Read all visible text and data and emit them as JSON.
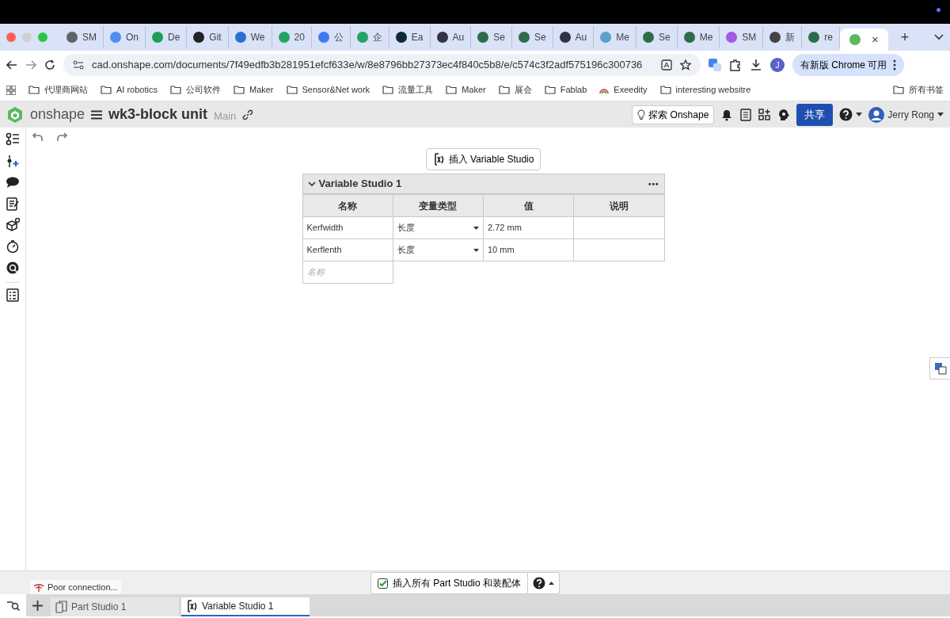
{
  "browser": {
    "tabs": [
      {
        "label": "SM",
        "color": "#5f6368",
        "selected": false
      },
      {
        "label": "On",
        "color": "#4f8df5",
        "selected": false
      },
      {
        "label": "De",
        "color": "#1e9e55",
        "selected": false
      },
      {
        "label": "Git",
        "color": "#222222",
        "selected": false
      },
      {
        "label": "We",
        "color": "#2a6fd6",
        "selected": false
      },
      {
        "label": "20",
        "color": "#21a464",
        "selected": false
      },
      {
        "label": "公",
        "color": "#3b7cf0",
        "selected": false
      },
      {
        "label": "企",
        "color": "#21a464",
        "selected": false
      },
      {
        "label": "Ea",
        "color": "#0d2a3a",
        "selected": false
      },
      {
        "label": "Au",
        "color": "#333344",
        "selected": false
      },
      {
        "label": "Se",
        "color": "#2e6b4a",
        "selected": false
      },
      {
        "label": "Se",
        "color": "#2e6b4a",
        "selected": false
      },
      {
        "label": "Au",
        "color": "#333344",
        "selected": false
      },
      {
        "label": "Me",
        "color": "#5aa0c8",
        "selected": false
      },
      {
        "label": "Se",
        "color": "#2e6b4a",
        "selected": false
      },
      {
        "label": "Me",
        "color": "#2e6b4a",
        "selected": false
      },
      {
        "label": "SM",
        "color": "#a259e6",
        "selected": false
      },
      {
        "label": "新",
        "color": "#444444",
        "selected": false
      },
      {
        "label": "re",
        "color": "#2e6b4a",
        "selected": false
      },
      {
        "color": "#5cb85c",
        "selected": true,
        "close": "×"
      }
    ],
    "new_tab": "+",
    "address": "cad.onshape.com/documents/7f49edfb3b281951efcf633e/w/8e8796bb27373ec4f840c5b8/e/c574c3f2adf575196c300736",
    "avatar": "J",
    "update_button": "有新版 Chrome 可用",
    "bookmarks": [
      {
        "label": "代理商网站",
        "kind": "folder"
      },
      {
        "label": "AI robotics",
        "kind": "folder"
      },
      {
        "label": "公司软件",
        "kind": "folder"
      },
      {
        "label": "Maker",
        "kind": "folder"
      },
      {
        "label": "Sensor&Net work",
        "kind": "folder"
      },
      {
        "label": "流量工具",
        "kind": "folder"
      },
      {
        "label": "Maker",
        "kind": "folder"
      },
      {
        "label": "展会",
        "kind": "folder"
      },
      {
        "label": "Fablab",
        "kind": "folder"
      },
      {
        "label": "Exeedity",
        "kind": "site"
      },
      {
        "label": "interesting websitre",
        "kind": "folder"
      }
    ],
    "all_bookmarks": "所有书签"
  },
  "app": {
    "logo": "onshape",
    "document": "wk3-block unit",
    "branch": "Main",
    "explore": "探索 Onshape",
    "share": "共享",
    "user": "Jerry Rong"
  },
  "insert_button": "插入 Variable Studio",
  "studio": {
    "title": "Variable Studio 1",
    "expanded": true,
    "menu": "•••",
    "columns": [
      "名称",
      "变量类型",
      "值",
      "说明"
    ],
    "rows": [
      {
        "name": "Kerfwidth",
        "type": "长度",
        "value": "2.72 mm"
      },
      {
        "name": "Kerflenth",
        "type": "长度",
        "value": "10 mm"
      }
    ],
    "new_name_placeholder": "名称"
  },
  "status": "Poor connection...",
  "insert_all": {
    "label": "插入所有 Part Studio 和装配体",
    "checked": true
  },
  "tabs": [
    {
      "label": "Part Studio 1",
      "kind": "part",
      "selected": false
    },
    {
      "label": "Variable Studio 1",
      "kind": "variable",
      "selected": true
    }
  ]
}
